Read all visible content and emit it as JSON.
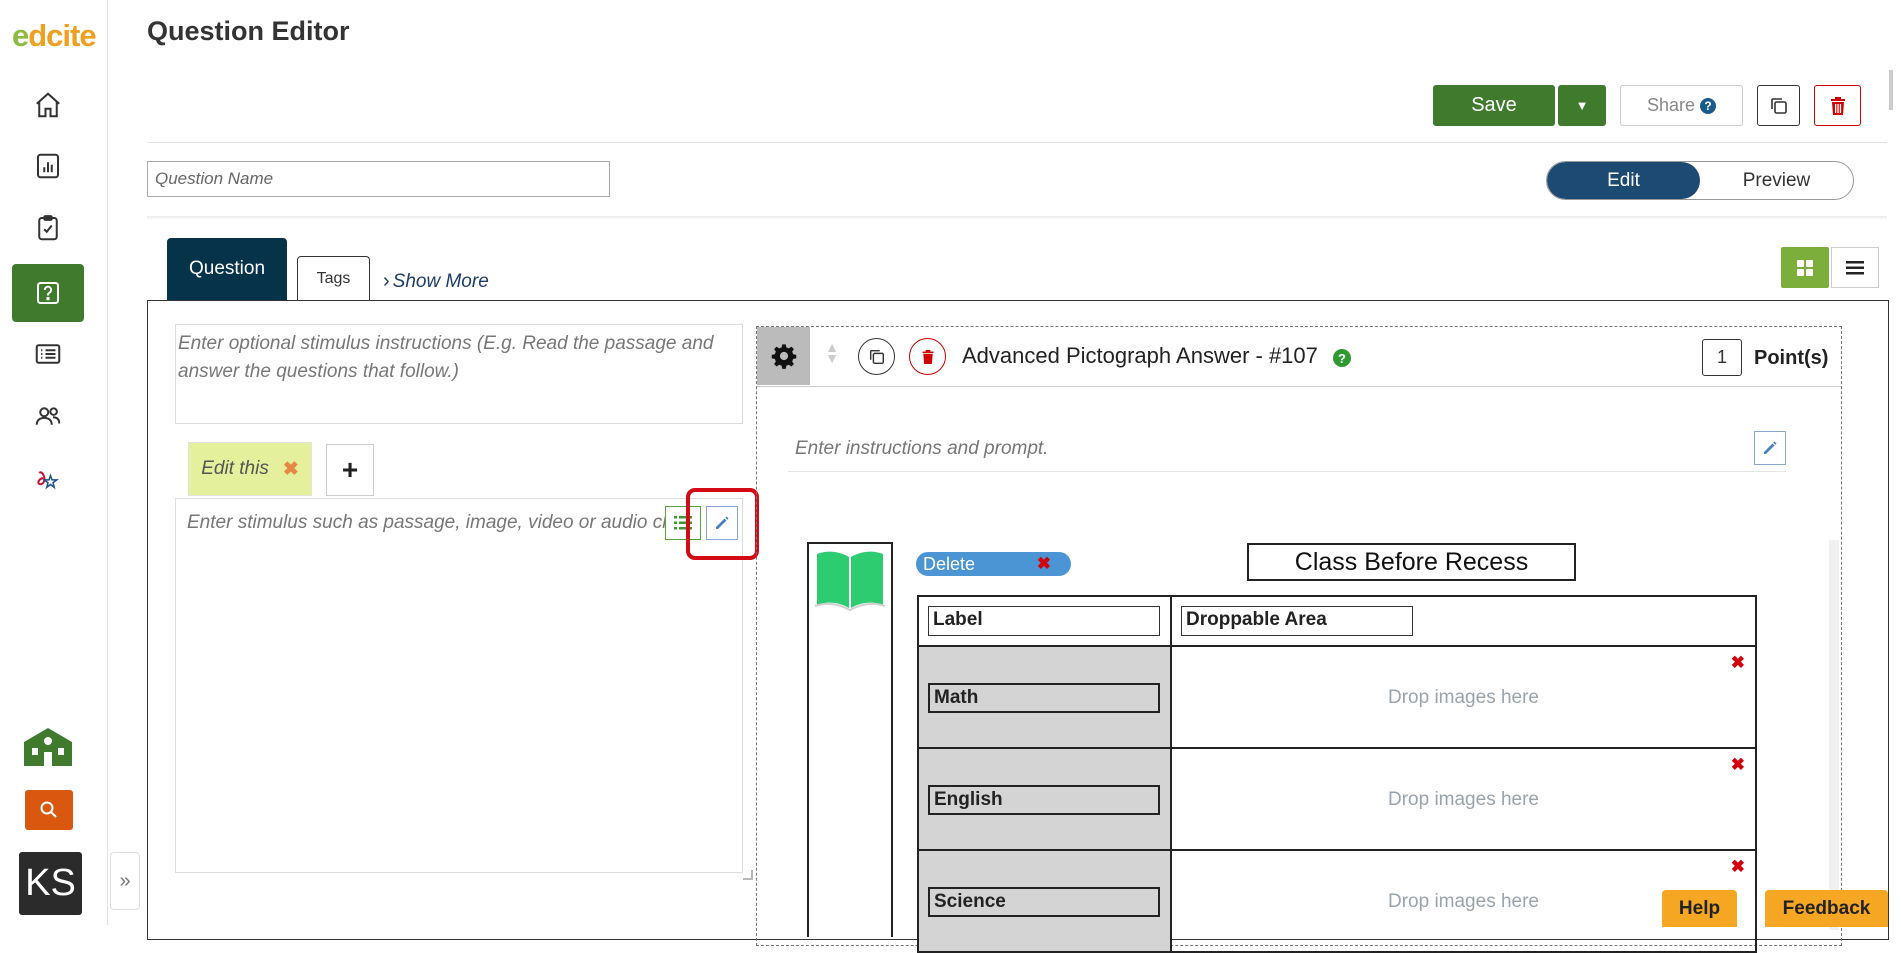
{
  "app": {
    "logo_e": "e",
    "logo_rest": "dcite",
    "avatar_initials": "KS"
  },
  "sidebar": {
    "items": [
      {
        "icon": "home-icon"
      },
      {
        "icon": "reports-icon"
      },
      {
        "icon": "assignments-icon"
      },
      {
        "icon": "question-icon",
        "active": true
      },
      {
        "icon": "list-icon"
      },
      {
        "icon": "users-icon"
      },
      {
        "icon": "state-logo-icon"
      }
    ]
  },
  "header": {
    "title": "Question Editor",
    "save_label": "Save",
    "share_label": "Share",
    "question_name_placeholder": "Question Name",
    "mode_edit": "Edit",
    "mode_preview": "Preview"
  },
  "tabs": {
    "question": "Question",
    "tags": "Tags",
    "show_more": "Show More"
  },
  "stimulus": {
    "instructions_placeholder": "Enter optional stimulus instructions (E.g. Read the passage and answer the questions that follow.)",
    "tab_label": "Edit this",
    "add_label": "+",
    "content_placeholder": "Enter stimulus such as passage, image, video or audio clip"
  },
  "question": {
    "title": "Advanced Pictograph Answer - #107",
    "points_value": "1",
    "points_label": "Point(s)",
    "prompt_placeholder": "Enter instructions and prompt."
  },
  "pictograph": {
    "delete_label": "Delete",
    "chart_title": "Class Before Recess",
    "header_label": "Label",
    "header_drop": "Droppable Area",
    "drop_placeholder": "Drop images here",
    "rows": [
      {
        "label": "Math"
      },
      {
        "label": "English"
      },
      {
        "label": "Science"
      }
    ]
  },
  "footer": {
    "help": "Help",
    "feedback": "Feedback"
  },
  "colors": {
    "primary_green": "#3f7a2d",
    "dark_blue": "#06324a",
    "accent_orange": "#f5a623",
    "highlight_red": "#d20a14"
  }
}
